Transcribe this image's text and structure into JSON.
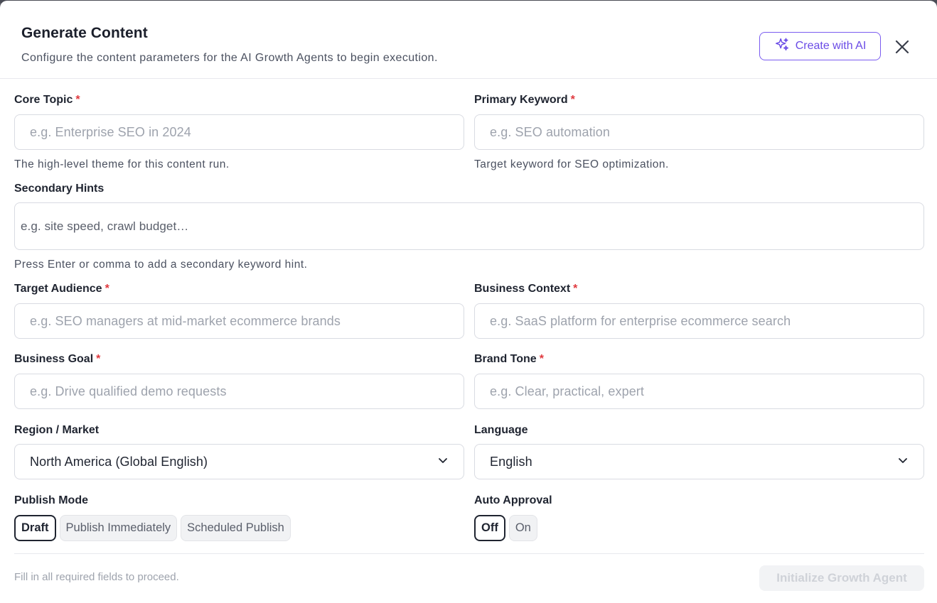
{
  "dialog": {
    "title": "Generate Content",
    "subtitle": "Configure the content parameters for the AI Growth Agents to begin execution.",
    "create_ai_label": "Create with AI"
  },
  "fields": {
    "core_topic": {
      "label": "Core Topic",
      "required": "*",
      "placeholder": "e.g. Enterprise SEO in 2024",
      "hint": "The high-level theme for this content run."
    },
    "primary_keyword": {
      "label": "Primary Keyword",
      "required": "*",
      "placeholder": "e.g. SEO automation",
      "hint": "Target keyword for SEO optimization."
    },
    "secondary_hints": {
      "label": "Secondary Hints",
      "placeholder": "e.g. site speed, crawl budget…",
      "hint": "Press Enter or comma to add a secondary keyword hint."
    },
    "target_audience": {
      "label": "Target Audience",
      "required": "*",
      "placeholder": "e.g. SEO managers at mid-market ecommerce brands"
    },
    "business_context": {
      "label": "Business Context",
      "required": "*",
      "placeholder": "e.g. SaaS platform for enterprise ecommerce search"
    },
    "business_goal": {
      "label": "Business Goal",
      "required": "*",
      "placeholder": "e.g. Drive qualified demo requests"
    },
    "brand_tone": {
      "label": "Brand Tone",
      "required": "*",
      "placeholder": "e.g. Clear, practical, expert"
    },
    "region": {
      "label": "Region / Market",
      "value": "North America (Global English)"
    },
    "language": {
      "label": "Language",
      "value": "English"
    },
    "publish_mode": {
      "label": "Publish Mode",
      "options": [
        "Draft",
        "Publish Immediately",
        "Scheduled Publish"
      ],
      "selected": "Draft"
    },
    "auto_approval": {
      "label": "Auto Approval",
      "options": [
        "Off",
        "On"
      ],
      "selected": "Off"
    }
  },
  "footer": {
    "hint": "Fill in all required fields to proceed.",
    "submit_label": "Initialize Growth Agent"
  },
  "colors": {
    "accent": "#6a4be6",
    "required": "#e0393e"
  }
}
